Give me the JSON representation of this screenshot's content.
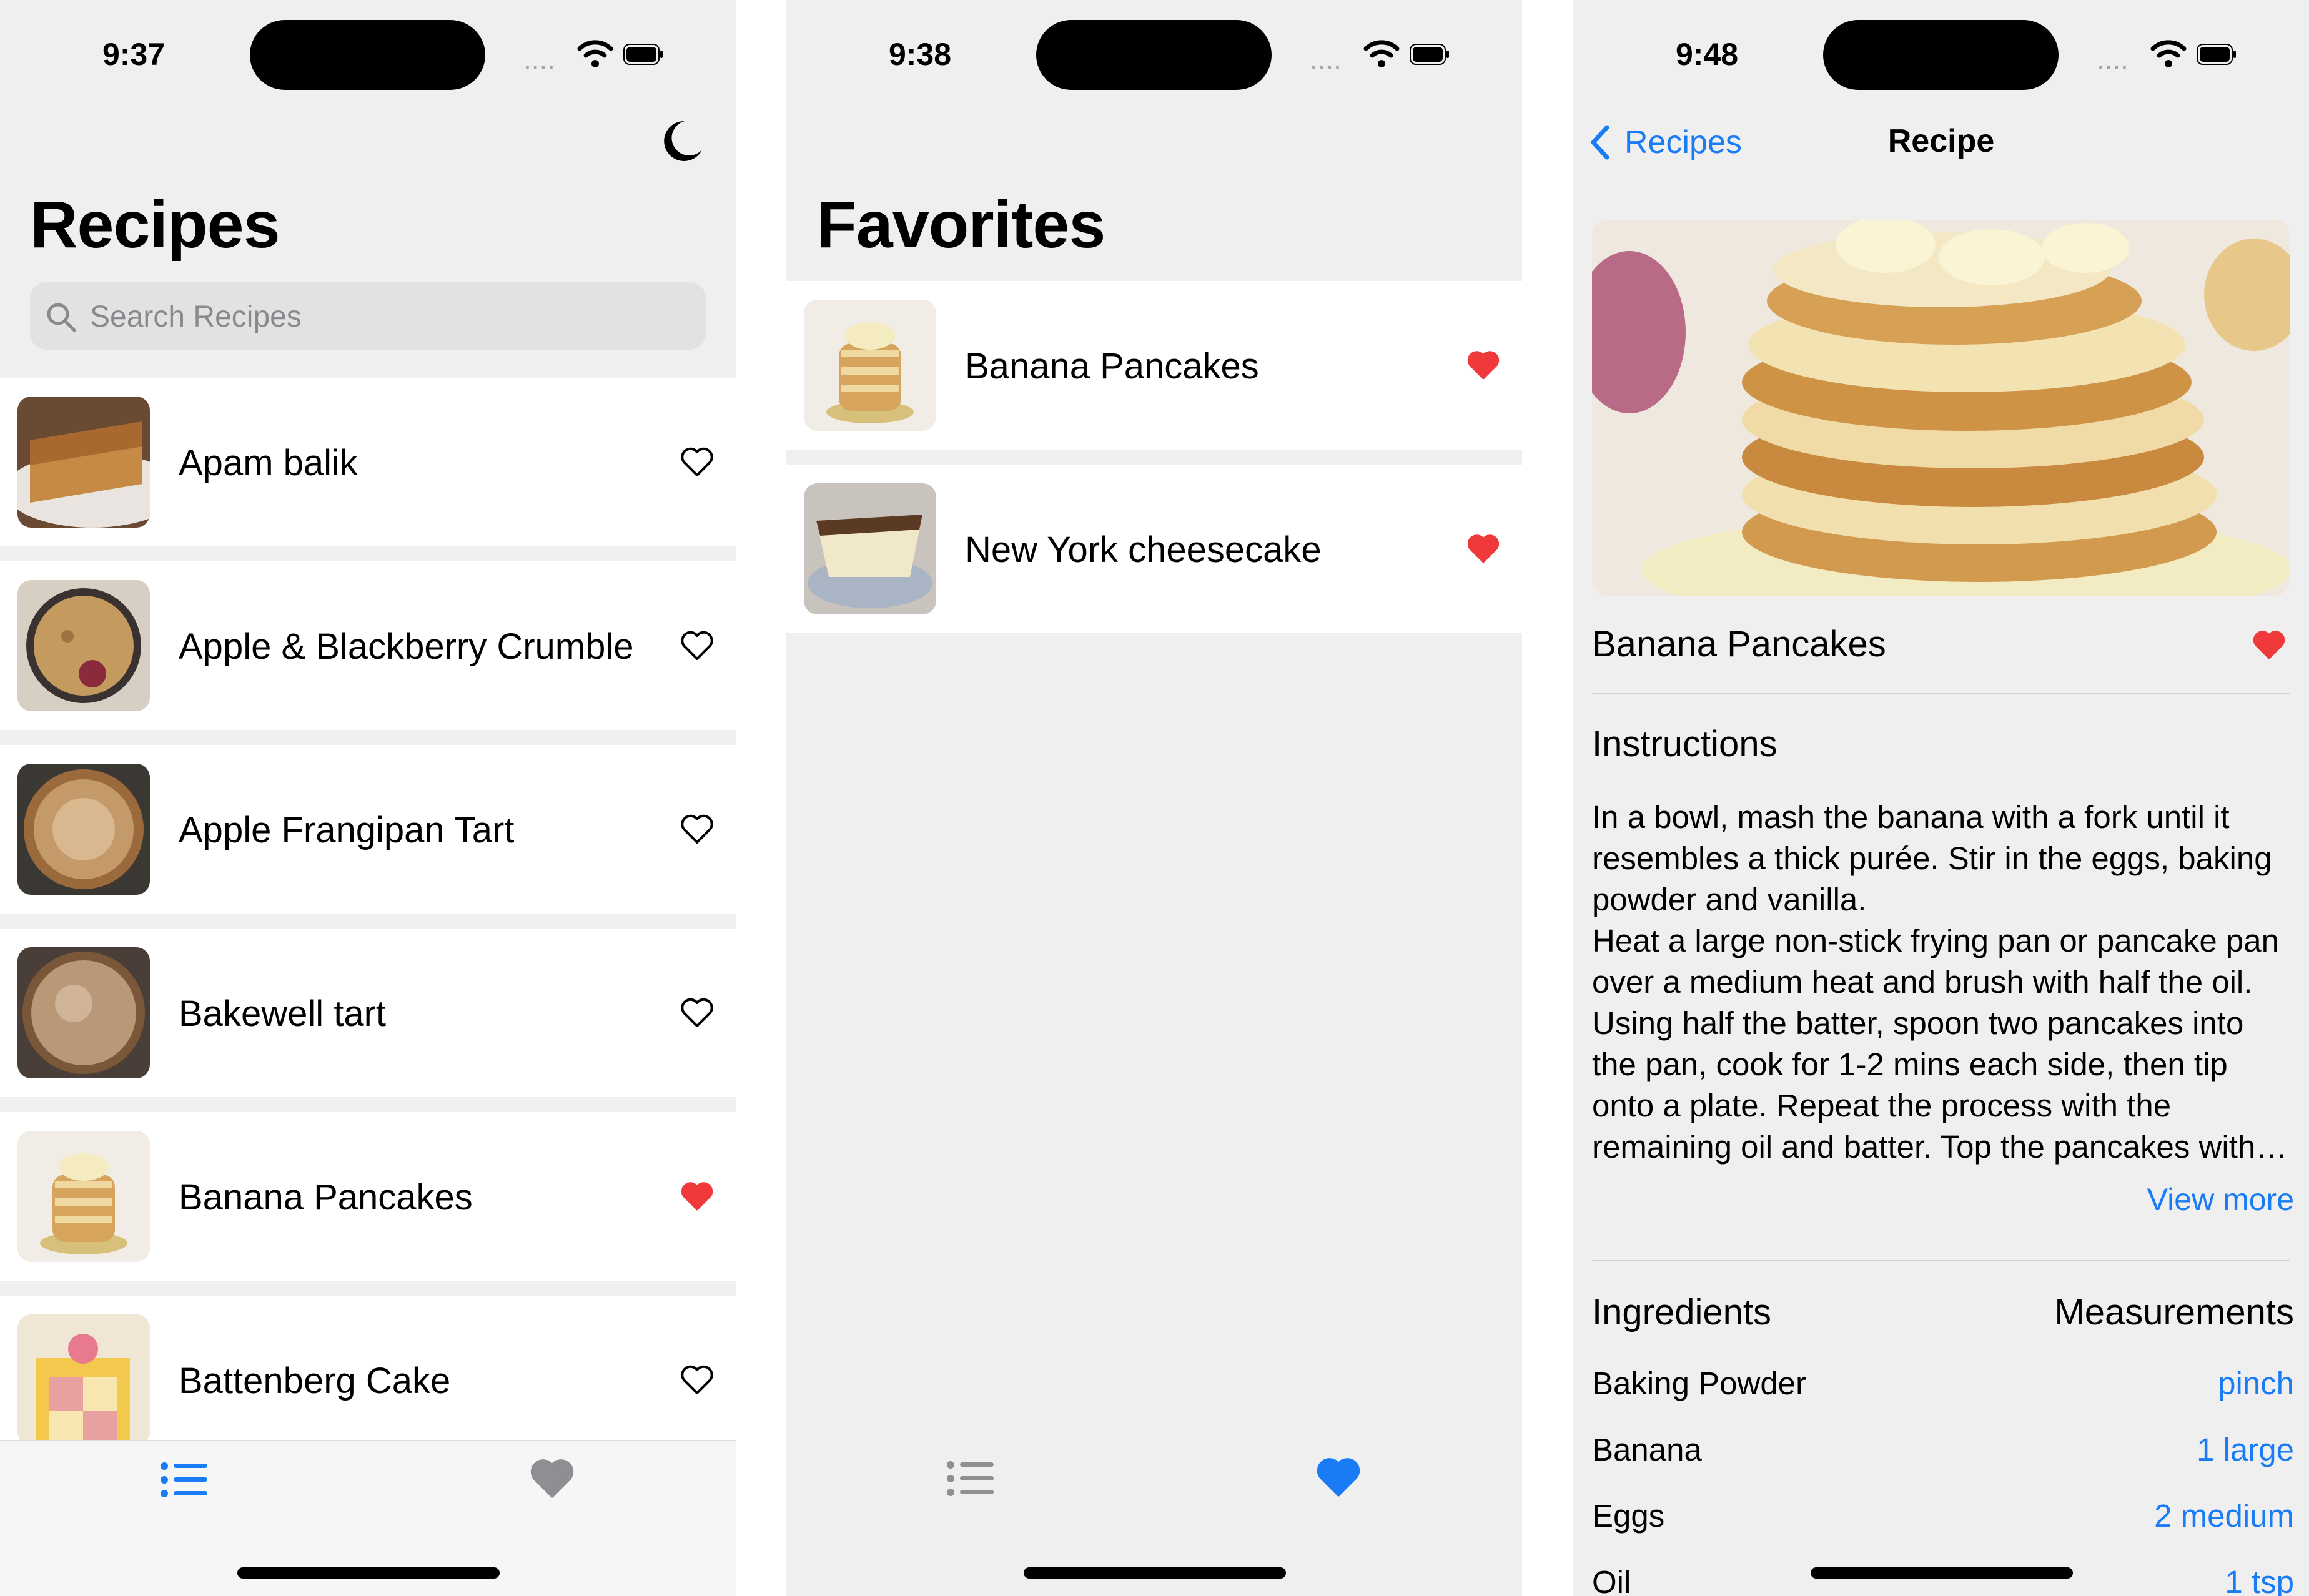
{
  "colors": {
    "accent": "#1a7cf5",
    "favorite": "#f0393a",
    "inactive_tab": "#8e8e93"
  },
  "screens": [
    {
      "status_time": "9:37",
      "title": "Recipes",
      "toolbar_icon": "moon-icon",
      "search_placeholder": "Search Recipes",
      "recipes": [
        {
          "name": "Apam balik",
          "favorite": false
        },
        {
          "name": "Apple & Blackberry Crumble",
          "favorite": false
        },
        {
          "name": "Apple Frangipan Tart",
          "favorite": false
        },
        {
          "name": "Bakewell tart",
          "favorite": false
        },
        {
          "name": "Banana Pancakes",
          "favorite": true
        },
        {
          "name": "Battenberg Cake",
          "favorite": false
        }
      ],
      "tabs": [
        {
          "icon": "list-icon",
          "selected": true
        },
        {
          "icon": "heart-icon",
          "selected": false
        }
      ]
    },
    {
      "status_time": "9:38",
      "title": "Favorites",
      "favorites": [
        {
          "name": "Banana Pancakes",
          "favorite": true
        },
        {
          "name": "New York cheesecake",
          "favorite": true
        }
      ],
      "tabs": [
        {
          "icon": "list-icon",
          "selected": false
        },
        {
          "icon": "heart-icon",
          "selected": true
        }
      ]
    },
    {
      "status_time": "9:48",
      "back_label": "Recipes",
      "nav_title": "Recipe",
      "recipe_name": "Banana Pancakes",
      "favorite": true,
      "instructions_title": "Instructions",
      "instructions": "In a bowl, mash the banana with a fork until it resembles a thick purée. Stir in the eggs, baking powder and vanilla.\nHeat a large non-stick frying pan or pancake pan over a medium heat and brush with half the oil. Using half the batter, spoon two pancakes into the pan, cook for 1-2 mins each side, then tip onto a plate. Repeat the process with the remaining oil and batter. Top the pancakes with pecans and raspberries.",
      "view_more": "View more",
      "ingredients_header": "Ingredients",
      "measurements_header": "Measurements",
      "ingredients": [
        {
          "name": "Baking Powder",
          "measure": "pinch"
        },
        {
          "name": "Banana",
          "measure": "1 large"
        },
        {
          "name": "Eggs",
          "measure": "2 medium"
        },
        {
          "name": "Oil",
          "measure": "1 tsp"
        }
      ]
    }
  ]
}
